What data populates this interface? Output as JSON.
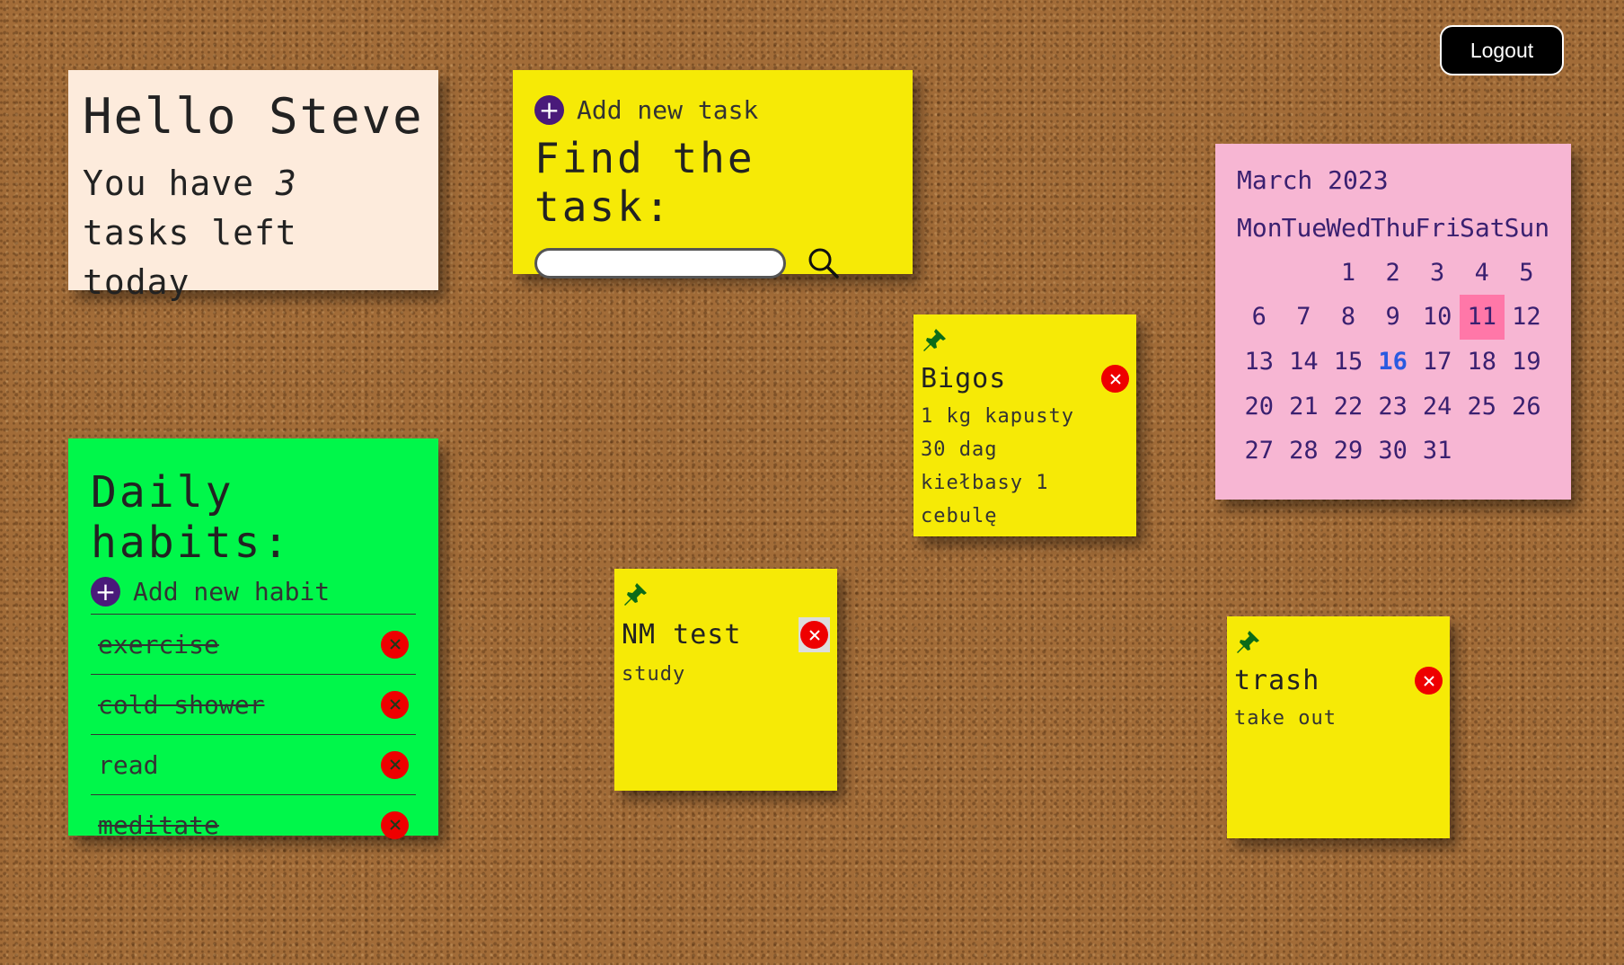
{
  "header": {
    "logout_label": "Logout"
  },
  "greeting": {
    "hello": "Hello Steve",
    "line_prefix": "You have ",
    "task_count": "3",
    "line_suffix": " tasks left today"
  },
  "finder": {
    "add_label": "Add new task",
    "title": "Find the task:",
    "search_value": ""
  },
  "habits": {
    "title": "Daily habits:",
    "add_label": "Add new habit",
    "items": [
      {
        "label": "exercise",
        "done": true
      },
      {
        "label": "cold shower",
        "done": true
      },
      {
        "label": "read",
        "done": false
      },
      {
        "label": "meditate",
        "done": true
      }
    ]
  },
  "notes": [
    {
      "title": "Bigos",
      "lines": [
        "1 kg kapusty",
        "30 dag",
        "kiełbasy 1",
        "cebulę"
      ]
    },
    {
      "title": "NM test",
      "lines": [
        "study"
      ]
    },
    {
      "title": "trash",
      "lines": [
        "take out"
      ]
    }
  ],
  "calendar": {
    "month_label": "March 2023",
    "weekdays": [
      "Mon",
      "Tue",
      "Wed",
      "Thu",
      "Fri",
      "Sat",
      "Sun"
    ],
    "days": [
      "",
      "",
      "1",
      "2",
      "3",
      "4",
      "5",
      "6",
      "7",
      "8",
      "9",
      "10",
      "11",
      "12",
      "13",
      "14",
      "15",
      "16",
      "17",
      "18",
      "19",
      "20",
      "21",
      "22",
      "23",
      "24",
      "25",
      "26",
      "27",
      "28",
      "29",
      "30",
      "31"
    ],
    "selected_day": "11",
    "highlighted_day": "16"
  },
  "colors": {
    "board": "#a26c38",
    "greeting_note": "#fdebdc",
    "yellow_note": "#f6ea06",
    "habits_note": "#00f74a",
    "calendar_note": "#f7b6d3",
    "calendar_today": "#ff77a8",
    "delete_red": "#ee0000",
    "plus_purple": "#4a1a7a",
    "pin_green": "#0b6b18"
  },
  "icons": [
    "plus-circle-icon",
    "search-icon",
    "close-icon",
    "pin-icon"
  ]
}
